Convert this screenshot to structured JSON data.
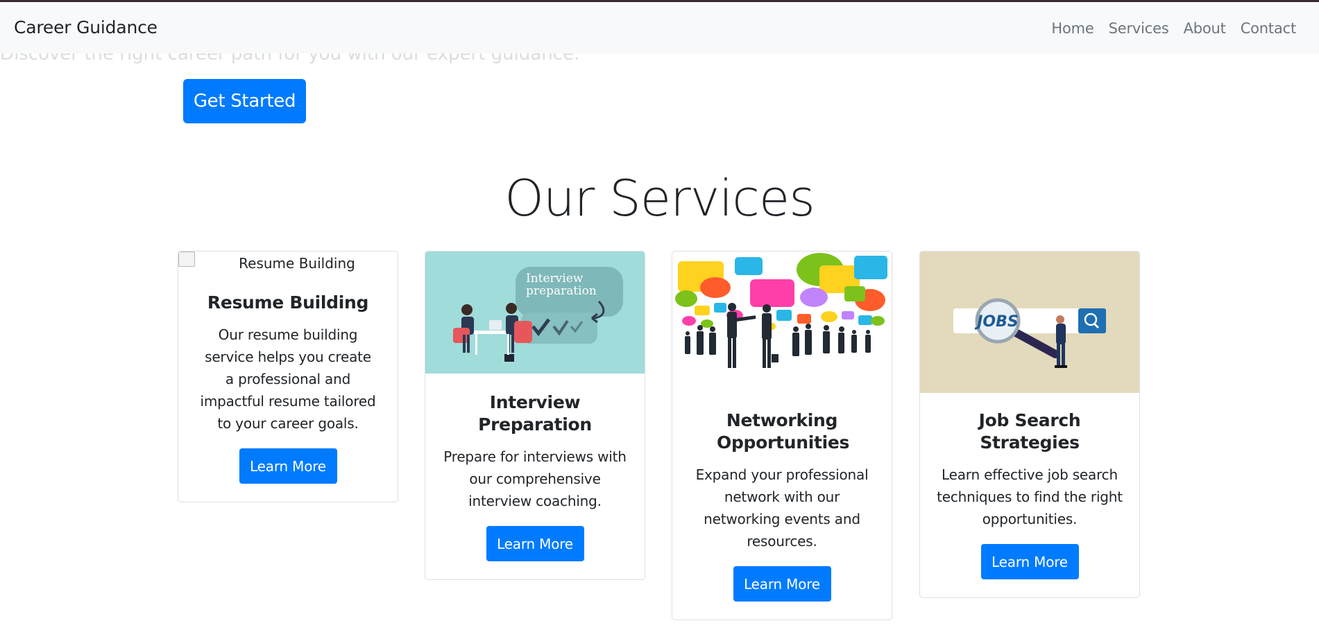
{
  "navbar": {
    "brand": "Career Guidance",
    "links": [
      "Home",
      "Services",
      "About",
      "Contact"
    ]
  },
  "hero": {
    "subtitle": "Discover the right career path for you with our expert guidance.",
    "cta_label": "Get Started"
  },
  "services": {
    "title": "Our Services",
    "cards": [
      {
        "image_alt": "Resume Building",
        "title": "Resume Building",
        "text": "Our resume building service helps you create a professional and impactful resume tailored to your career goals.",
        "button": "Learn More"
      },
      {
        "image_label": "Interview preparation",
        "title": "Interview Preparation",
        "text": "Prepare for interviews with our comprehensive interview coaching.",
        "button": "Learn More"
      },
      {
        "title": "Networking Opportunities",
        "text": "Expand your professional network with our networking events and resources.",
        "button": "Learn More"
      },
      {
        "image_label": "JOBS",
        "title": "Job Search Strategies",
        "text": "Learn effective job search techniques to find the right opportunities.",
        "button": "Learn More"
      }
    ]
  },
  "colors": {
    "primary": "#007bff",
    "navbar_bg": "#f8f9fa",
    "interview_bg": "#a0dcda",
    "jobs_bg": "#e3d9bc"
  }
}
